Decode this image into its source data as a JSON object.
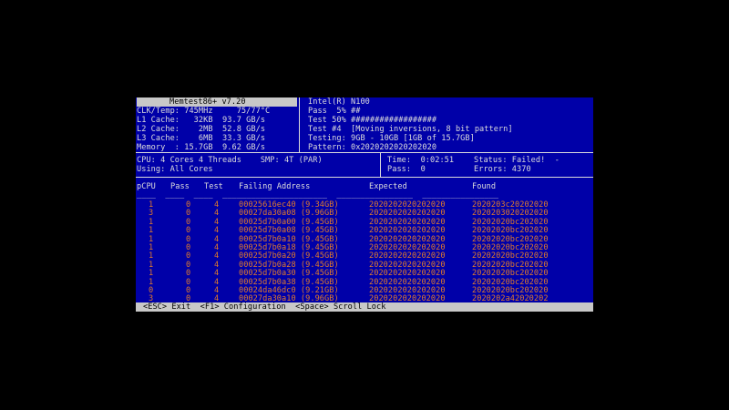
{
  "title": "Memtest86+ v7.20",
  "system": {
    "clk": "CLK/Temp: 745MHz     75/77°C",
    "l1": "L1 Cache:   32KB  93.7 GB/s",
    "l2": "L2 Cache:    2MB  52.8 GB/s",
    "l3": "L3 Cache:    6MB  33.3 GB/s",
    "mem": "Memory  : 15.7GB  9.62 GB/s"
  },
  "cpu_info": {
    "name": "Intel(R) N100",
    "pass": "Pass  5% ##",
    "test_progress": "Test 50% ##################",
    "test_name": "Test #4  [Moving inversions, 8 bit pattern]",
    "testing": "Testing: 9GB - 10GB [1GB of 15.7GB]",
    "pattern": "Pattern: 0x2020202020202020"
  },
  "cpu_line": "CPU: 4 Cores 4 Threads    SMP: 4T (PAR)",
  "using_line": "Using: All Cores",
  "status": {
    "time": "Time:  0:02:51",
    "status": "Status: Failed!  -",
    "pass": "Pass:  0",
    "errors": "Errors: 4370"
  },
  "table": {
    "headers": [
      "pCPU",
      "Pass",
      "Test",
      "Failing Address",
      "Expected",
      "Found"
    ],
    "underline": "____  ____  ____  ______________________  ________________  ________________",
    "rows": [
      [
        "1",
        "0",
        "4",
        "00025616ec40 (9.34GB)",
        "2020202020202020",
        "2020203c20202020"
      ],
      [
        "3",
        "0",
        "4",
        "00027da30a08 (9.96GB)",
        "2020202020202020",
        "2020203020202020"
      ],
      [
        "1",
        "0",
        "4",
        "00025d7b0a00 (9.45GB)",
        "2020202020202020",
        "20202020bc202020"
      ],
      [
        "1",
        "0",
        "4",
        "00025d7b0a08 (9.45GB)",
        "2020202020202020",
        "20202020bc202020"
      ],
      [
        "1",
        "0",
        "4",
        "00025d7b0a10 (9.45GB)",
        "2020202020202020",
        "20202020bc202020"
      ],
      [
        "1",
        "0",
        "4",
        "00025d7b0a18 (9.45GB)",
        "2020202020202020",
        "20202020bc202020"
      ],
      [
        "1",
        "0",
        "4",
        "00025d7b0a20 (9.45GB)",
        "2020202020202020",
        "20202020bc202020"
      ],
      [
        "1",
        "0",
        "4",
        "00025d7b0a28 (9.45GB)",
        "2020202020202020",
        "20202020bc202020"
      ],
      [
        "1",
        "0",
        "4",
        "00025d7b0a30 (9.45GB)",
        "2020202020202020",
        "20202020bc202020"
      ],
      [
        "1",
        "0",
        "4",
        "00025d7b0a38 (9.45GB)",
        "2020202020202020",
        "20202020bc202020"
      ],
      [
        "0",
        "0",
        "4",
        "00024da46dc0 (9.21GB)",
        "2020202020202020",
        "20202020bc202020"
      ],
      [
        "3",
        "0",
        "4",
        "00027da30a10 (9.96GB)",
        "2020202020202020",
        "2020202a42020202"
      ]
    ]
  },
  "footer": "<ESC> Exit  <F1> Configuration  <Space> Scroll Lock",
  "colors": {
    "background": "#0000a8",
    "text": "#dcdcdc",
    "error_text": "#e07a2a",
    "bar": "#c8c8c8"
  }
}
